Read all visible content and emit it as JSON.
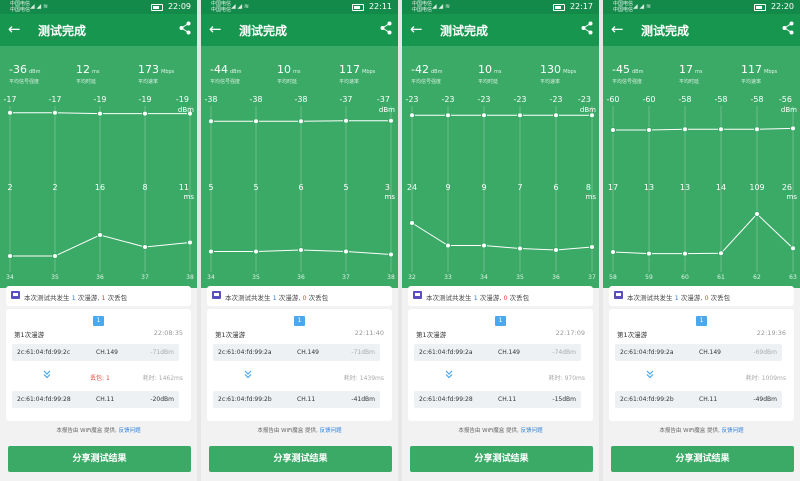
{
  "app": {
    "carrier": "中国电信\n中国电信",
    "signal": "◢ ◢ ≋",
    "title": "测试完成",
    "col_signal": "平均信号强度",
    "col_latency": "平均时延",
    "col_rate": "平均速率",
    "unit_signal": "dBm",
    "unit_latency": "ms",
    "unit_rate": "Mbps",
    "axis_dbm": "dBm",
    "axis_ms": "ms",
    "summary_pre": "本次测试共发生",
    "summary_mid1": "次漫游,",
    "summary_mid2": "次丢包",
    "roam_label": "第1次漫游",
    "cost_label": "耗时:",
    "loss_label": "丢包:",
    "footer_text": "本报告由 WiFi魔盒 提供,",
    "footer_link": "反馈问题",
    "share_button": "分享测试结果",
    "accent": "#3aaa66",
    "header_green": "#17964f"
  },
  "phones": [
    {
      "status_time": "22:09",
      "avg_signal": "-36",
      "avg_latency": "12",
      "avg_rate": "173",
      "roam_count": "1",
      "loss_count": "1",
      "roam_badge": "1",
      "roam_time": "22:08:35",
      "ap1": {
        "mac": "2c:61:04:fd:99:2c",
        "channel": "CH.149",
        "dbm": "-71dBm"
      },
      "ap2": {
        "mac": "2c:61:04:fd:99:28",
        "channel": "CH.11",
        "dbm": "-20dBm"
      },
      "loss_value": "1",
      "cost_value": "1462ms",
      "chart_data": {
        "type": "line",
        "x": [
          "34",
          "35",
          "36",
          "37",
          "38"
        ],
        "signal_labels": [
          "-17",
          "-17",
          "-19",
          "-19",
          "-19"
        ],
        "latency_labels": [
          "2",
          "2",
          "16",
          "8",
          "11"
        ],
        "signal_values": [
          -17,
          -17,
          -19,
          -19,
          -19
        ],
        "latency_values": [
          2,
          2,
          16,
          8,
          11
        ]
      }
    },
    {
      "status_time": "22:11",
      "avg_signal": "-44",
      "avg_latency": "10",
      "avg_rate": "117",
      "roam_count": "1",
      "loss_count": "0",
      "roam_badge": "1",
      "roam_time": "22:11:40",
      "ap1": {
        "mac": "2c:61:04:fd:99:2a",
        "channel": "CH.149",
        "dbm": "-71dBm"
      },
      "ap2": {
        "mac": "2c:61:04:fd:99:2b",
        "channel": "CH.11",
        "dbm": "-41dBm"
      },
      "loss_value": "",
      "cost_value": "1439ms",
      "chart_data": {
        "type": "line",
        "x": [
          "34",
          "35",
          "36",
          "37",
          "38"
        ],
        "signal_labels": [
          "-38",
          "-38",
          "-38",
          "-37",
          "-37"
        ],
        "latency_labels": [
          "5",
          "5",
          "6",
          "5",
          "3"
        ],
        "signal_values": [
          -38,
          -38,
          -38,
          -37,
          -37
        ],
        "latency_values": [
          5,
          5,
          6,
          5,
          3
        ]
      }
    },
    {
      "status_time": "22:17",
      "avg_signal": "-42",
      "avg_latency": "10",
      "avg_rate": "130",
      "roam_count": "1",
      "loss_count": "0",
      "roam_badge": "1",
      "roam_time": "22:17:09",
      "ap1": {
        "mac": "2c:61:04:fd:99:2a",
        "channel": "CH.149",
        "dbm": "-74dBm"
      },
      "ap2": {
        "mac": "2c:61:04:fd:99:28",
        "channel": "CH.11",
        "dbm": "-15dBm"
      },
      "loss_value": "",
      "cost_value": "970ms",
      "chart_data": {
        "type": "line",
        "x": [
          "32",
          "33",
          "34",
          "35",
          "36",
          "37"
        ],
        "signal_labels": [
          "-23",
          "-23",
          "-23",
          "-23",
          "-23",
          "-23"
        ],
        "latency_labels": [
          "24",
          "9",
          "9",
          "7",
          "6",
          "8"
        ],
        "signal_values": [
          -23,
          -23,
          -23,
          -23,
          -23,
          -23
        ],
        "latency_values": [
          24,
          9,
          9,
          7,
          6,
          8
        ]
      }
    },
    {
      "status_time": "22:20",
      "avg_signal": "-45",
      "avg_latency": "17",
      "avg_rate": "117",
      "roam_count": "1",
      "loss_count": "0",
      "roam_badge": "1",
      "roam_time": "22:19:36",
      "ap1": {
        "mac": "2c:61:04:fd:99:2a",
        "channel": "CH.149",
        "dbm": "-69dBm"
      },
      "ap2": {
        "mac": "2c:61:04:fd:99:2b",
        "channel": "CH.11",
        "dbm": "-49dBm"
      },
      "loss_value": "",
      "cost_value": "1009ms",
      "chart_data": {
        "type": "line",
        "x": [
          "58",
          "59",
          "60",
          "61",
          "62",
          "63"
        ],
        "signal_labels": [
          "-60",
          "-60",
          "-58",
          "-58",
          "-58",
          "-56"
        ],
        "latency_labels": [
          "17",
          "13",
          "13",
          "14",
          "109",
          "26"
        ],
        "signal_values": [
          -60,
          -60,
          -58,
          -58,
          -58,
          -56
        ],
        "latency_values": [
          17,
          13,
          13,
          14,
          109,
          26
        ]
      }
    }
  ]
}
